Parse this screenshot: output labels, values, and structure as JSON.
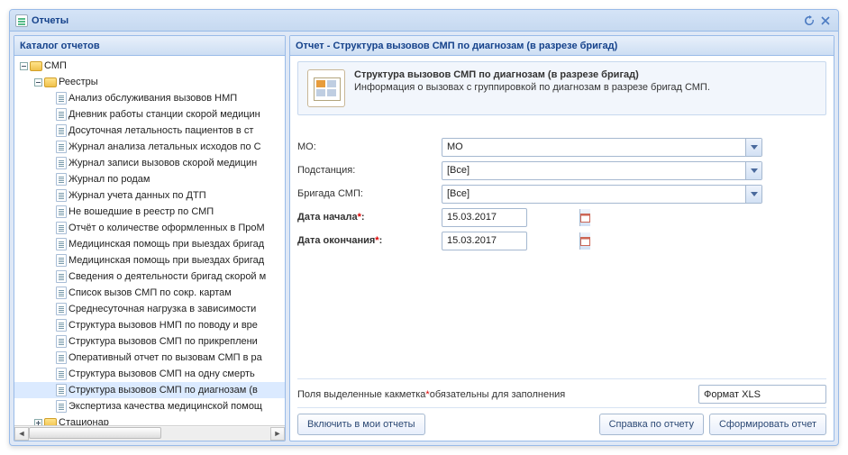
{
  "window": {
    "title": "Отчеты"
  },
  "catalog": {
    "header": "Каталог отчетов",
    "root": "СМП",
    "folders": {
      "reestry": "Реестры",
      "stacionar": "Стационар"
    },
    "items": [
      "Анализ обслуживания вызовов НМП",
      "Дневник работы станции скорой медицин",
      "Досуточная летальность пациентов в ст",
      "Журнал анализа летальных исходов по С",
      "Журнал записи вызовов скорой медицин",
      "Журнал по родам",
      "Журнал учета данных по ДТП",
      "Не вошедшие в реестр по СМП",
      "Отчёт о количестве оформленных в ПроМ",
      "Медицинская помощь при выездах бригад",
      "Медицинская помощь при выездах бригад",
      "Сведения о деятельности бригад скорой м",
      "Список вызов СМП по сокр. картам",
      "Среднесуточная нагрузка в зависимости",
      "Структура вызовов НМП по поводу и вре",
      "Структура вызовов СМП по прикреплени",
      "Оперативный отчет по вызовам СМП в ра",
      "Структура вызовов СМП на одну смерть",
      "Структура вызовов СМП по диагнозам (в",
      "Экспертиза качества медицинской помощ"
    ],
    "selected_index": 18
  },
  "report": {
    "header": "Отчет - Структура вызовов СМП по диагнозам (в разрезе бригад)",
    "info_title": "Структура вызовов СМП по диагнозам (в разрезе бригад)",
    "info_desc": "Информация о вызовах с группировкой по диагнозам в разрезе бригад СМП.",
    "fields": {
      "mo_label": "МО:",
      "mo_value": "МО",
      "substation_label": "Подстанция:",
      "substation_value": "[Все]",
      "brigade_label": "Бригада СМП:",
      "brigade_value": "[Все]",
      "date_start_label": "Дата начала",
      "date_start_value": "15.03.2017",
      "date_end_label": "Дата окончания",
      "date_end_value": "15.03.2017"
    },
    "hint_prefix": "Поля выделенные как ",
    "hint_word": "метка",
    "hint_suffix": " обязательны для заполнения",
    "format_value": "Формат XLS",
    "buttons": {
      "add_to_my": "Включить в мои отчеты",
      "help": "Справка по отчету",
      "generate": "Сформировать отчет"
    }
  }
}
